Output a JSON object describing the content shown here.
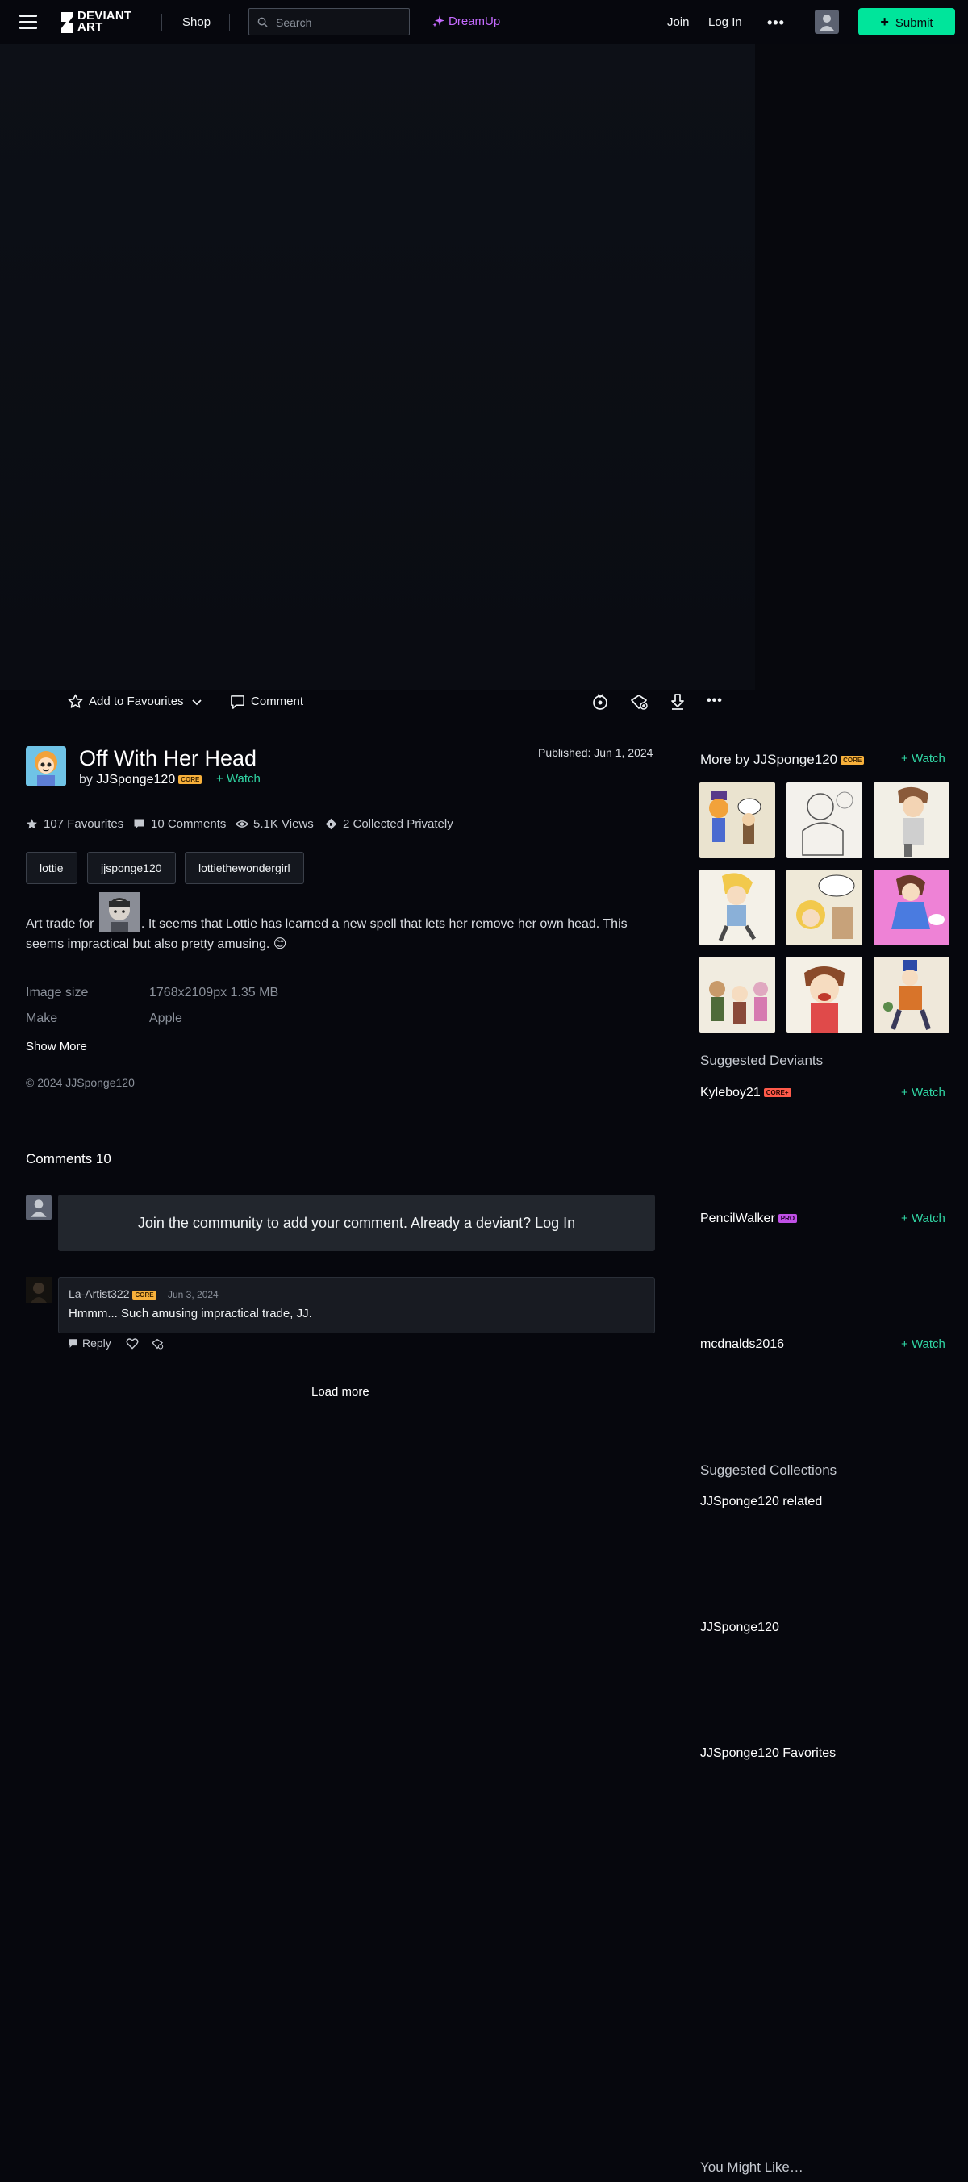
{
  "header": {
    "logo_text": "DEVIANT ART",
    "shop": "Shop",
    "search_placeholder": "Search",
    "dreamup": "DreamUp",
    "join": "Join",
    "login": "Log In",
    "more": "•••",
    "submit": "Submit",
    "colors": {
      "accent": "#00e59b",
      "dreamup": "#c56bff",
      "background": "#06070d"
    }
  },
  "actions": {
    "add_to_favourites": "Add to Favourites",
    "comment": "Comment",
    "icons": [
      "award-icon",
      "gift-icon",
      "download-icon",
      "more-icon"
    ]
  },
  "deviation": {
    "title": "Off With Her Head",
    "by": "by",
    "author": "JJSponge120",
    "author_badge": "CORE",
    "watch": "Watch",
    "published": "Published: Jun 1, 2024",
    "stats": {
      "favourites": "107 Favourites",
      "comments": "10 Comments",
      "views": "5.1K Views",
      "collected": "2 Collected Privately"
    },
    "tags": [
      "lottie",
      "jjsponge120",
      "lottiethewondergirl"
    ],
    "description_before": "Art trade for ",
    "description_after": ". It seems that Lottie has learned a new spell that lets her remove her own head. This seems impractical but also pretty amusing. 😊",
    "meta": [
      {
        "key": "Image size",
        "value": "1768x2109px 1.35 MB"
      },
      {
        "key": "Make",
        "value": "Apple"
      }
    ],
    "show_more": "Show More",
    "copyright": "© 2024 JJSponge120"
  },
  "comments": {
    "heading": "Comments 10",
    "join_prompt": "Join the community to add your comment. Already a deviant? Log In",
    "items": [
      {
        "author": "La-Artist322",
        "badge": "CORE",
        "date": "Jun 3, 2024",
        "text": "Hmmm... Such amusing impractical trade, JJ.",
        "reply": "Reply"
      }
    ],
    "load_more": "Load more"
  },
  "sidebar": {
    "more_by": "More by JJSponge120",
    "more_by_badge": "CORE",
    "watch": "Watch",
    "suggested_deviants_heading": "Suggested Deviants",
    "deviants": [
      {
        "name": "Kyleboy21",
        "badge": "CORE+"
      },
      {
        "name": "PencilWalker",
        "badge": "PRO"
      },
      {
        "name": "mcdnalds2016",
        "badge": ""
      }
    ],
    "suggested_collections_heading": "Suggested Collections",
    "collections": [
      "JJSponge120 related",
      "JJSponge120",
      "JJSponge120 Favorites"
    ],
    "you_might_like": "You Might Like…"
  }
}
